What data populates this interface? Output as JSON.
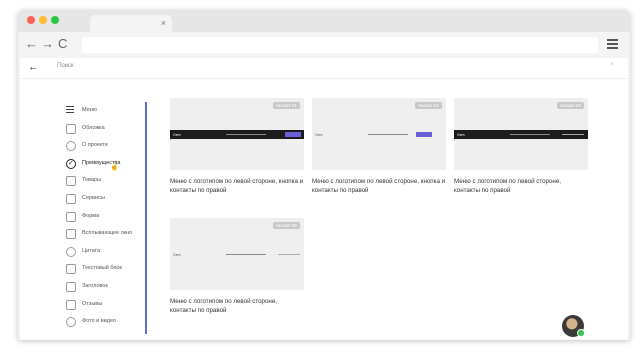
{
  "browser": {
    "tab_close": "×",
    "back": "←",
    "forward": "→",
    "reload": "C"
  },
  "searchbar": {
    "back": "←",
    "placeholder": "Поиск",
    "clear": "×"
  },
  "sidebar": {
    "items": [
      {
        "label": "Меню",
        "icon": "menu-icon"
      },
      {
        "label": "Обложка",
        "icon": "cover-icon"
      },
      {
        "label": "О проекте",
        "icon": "info-icon"
      },
      {
        "label": "Преимущества",
        "icon": "check-circle-icon"
      },
      {
        "label": "Товары",
        "icon": "bag-icon"
      },
      {
        "label": "Сервисы",
        "icon": "services-icon"
      },
      {
        "label": "Форма",
        "icon": "form-icon"
      },
      {
        "label": "Всплывающее окно",
        "icon": "popup-icon"
      },
      {
        "label": "Цитата",
        "icon": "quote-icon"
      },
      {
        "label": "Текстовый блок",
        "icon": "text-block-icon"
      },
      {
        "label": "Заголовок",
        "icon": "heading-icon"
      },
      {
        "label": "Отзывы",
        "icon": "reviews-icon"
      },
      {
        "label": "Фото и видео",
        "icon": "media-icon"
      }
    ]
  },
  "cards": [
    {
      "badge": "Header-01",
      "logo": "Gem",
      "caption": "Меню с логотипом по левой стороне, кнопка и контакты по правой"
    },
    {
      "badge": "Header-02",
      "logo": "Gem",
      "caption": "Меню с логотипом по левой стороне, кнопка и контакты по правой"
    },
    {
      "badge": "Header-04",
      "logo": "Gem",
      "caption": "Меню с логотипом по левой стороне, контакты по правой"
    },
    {
      "badge": "Header-05",
      "logo": "Gem",
      "caption": "Меню с логотипом по левой стороне, контакты по правой"
    }
  ],
  "colors": {
    "accent": "#5b6fd6",
    "button": "#6a5fd6",
    "online": "#32c24d"
  }
}
